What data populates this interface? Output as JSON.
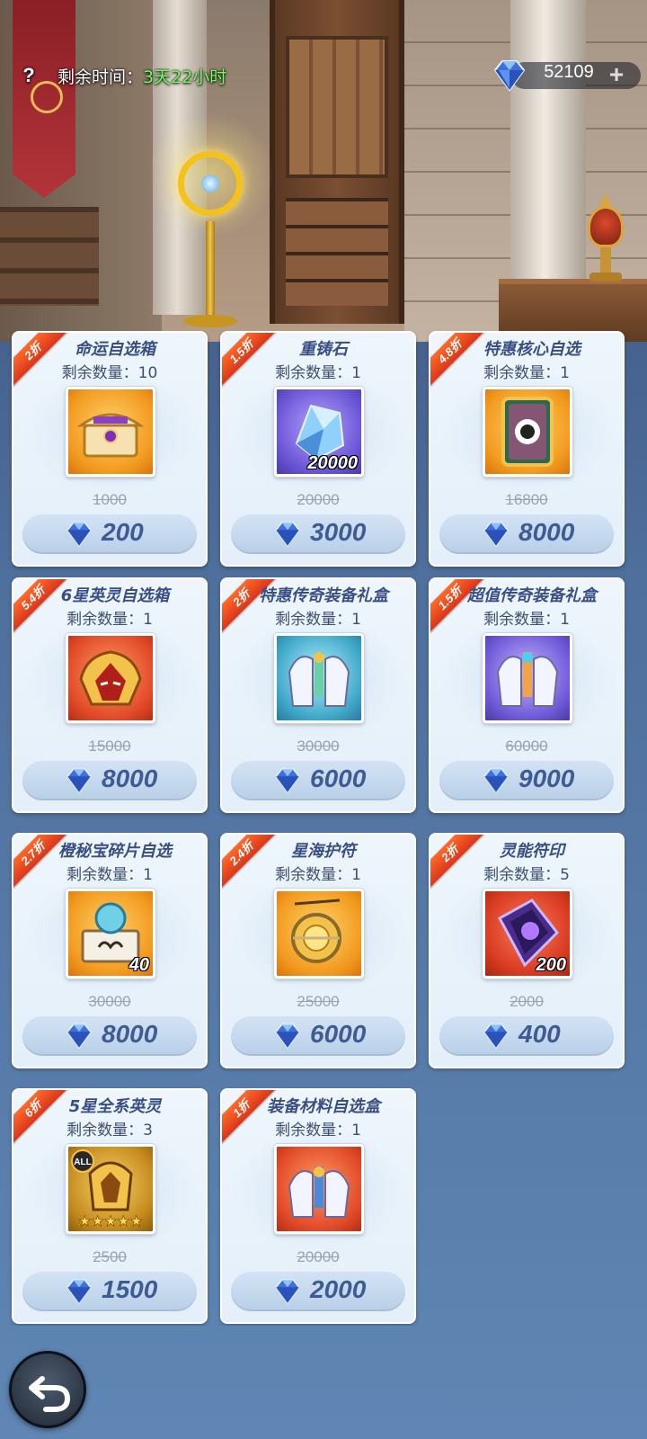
{
  "header": {
    "help_symbol": "?",
    "time_label": "剩余时间：",
    "time_value": "3天22小时",
    "currency_amount": "52109",
    "plus_symbol": "+",
    "currency_icon": "diamond-icon"
  },
  "colors": {
    "accent_green": "#6cff5a",
    "discount_ribbon": "#e8441e",
    "price_text": "#3f5b94",
    "title_text": "#3a4e86"
  },
  "shop": {
    "items": [
      {
        "discount": "2折",
        "name": "命运自选箱",
        "stock": "剩余数量：10",
        "qty": "",
        "old_price": "1000",
        "price": "200",
        "icon": "treasure-chest-icon"
      },
      {
        "discount": "1.5折",
        "name": "重铸石",
        "stock": "剩余数量：1",
        "qty": "20000",
        "old_price": "20000",
        "price": "3000",
        "icon": "crystal-stone-icon"
      },
      {
        "discount": "4.8折",
        "name": "特惠核心自选",
        "stock": "剩余数量：1",
        "qty": "",
        "old_price": "16800",
        "price": "8000",
        "icon": "core-card-icon"
      },
      {
        "discount": "5.4折",
        "name": "6星英灵自选箱",
        "stock": "剩余数量：1",
        "qty": "",
        "old_price": "15000",
        "price": "8000",
        "icon": "hero-mask-icon"
      },
      {
        "discount": "2折",
        "name": "特惠传奇装备礼盒",
        "stock": "剩余数量：1",
        "qty": "",
        "old_price": "30000",
        "price": "6000",
        "icon": "armor-giftbox-icon"
      },
      {
        "discount": "1.5折",
        "name": "超值传奇装备礼盒",
        "stock": "剩余数量：1",
        "qty": "",
        "old_price": "60000",
        "price": "9000",
        "icon": "armor-giftbox-icon"
      },
      {
        "discount": "2.7折",
        "name": "橙秘宝碎片自选",
        "stock": "剩余数量：1",
        "qty": "40",
        "old_price": "30000",
        "price": "8000",
        "icon": "treasure-fragment-icon"
      },
      {
        "discount": "2.4折",
        "name": "星海护符",
        "stock": "剩余数量：1",
        "qty": "",
        "old_price": "25000",
        "price": "6000",
        "icon": "amulet-icon"
      },
      {
        "discount": "2折",
        "name": "灵能符印",
        "stock": "剩余数量：5",
        "qty": "200",
        "old_price": "2000",
        "price": "400",
        "icon": "psionic-seal-icon"
      },
      {
        "discount": "6折",
        "name": "5星全系英灵",
        "stock": "剩余数量：3",
        "qty": "",
        "old_price": "2500",
        "price": "1500",
        "icon": "all-hero-icon",
        "badge": "ALL",
        "stars": "★★★★★"
      },
      {
        "discount": "1折",
        "name": "装备材料自选盒",
        "stock": "剩余数量：1",
        "qty": "",
        "old_price": "20000",
        "price": "2000",
        "icon": "equipment-material-icon"
      }
    ]
  },
  "footer": {
    "back_icon": "back-arrow-icon"
  }
}
